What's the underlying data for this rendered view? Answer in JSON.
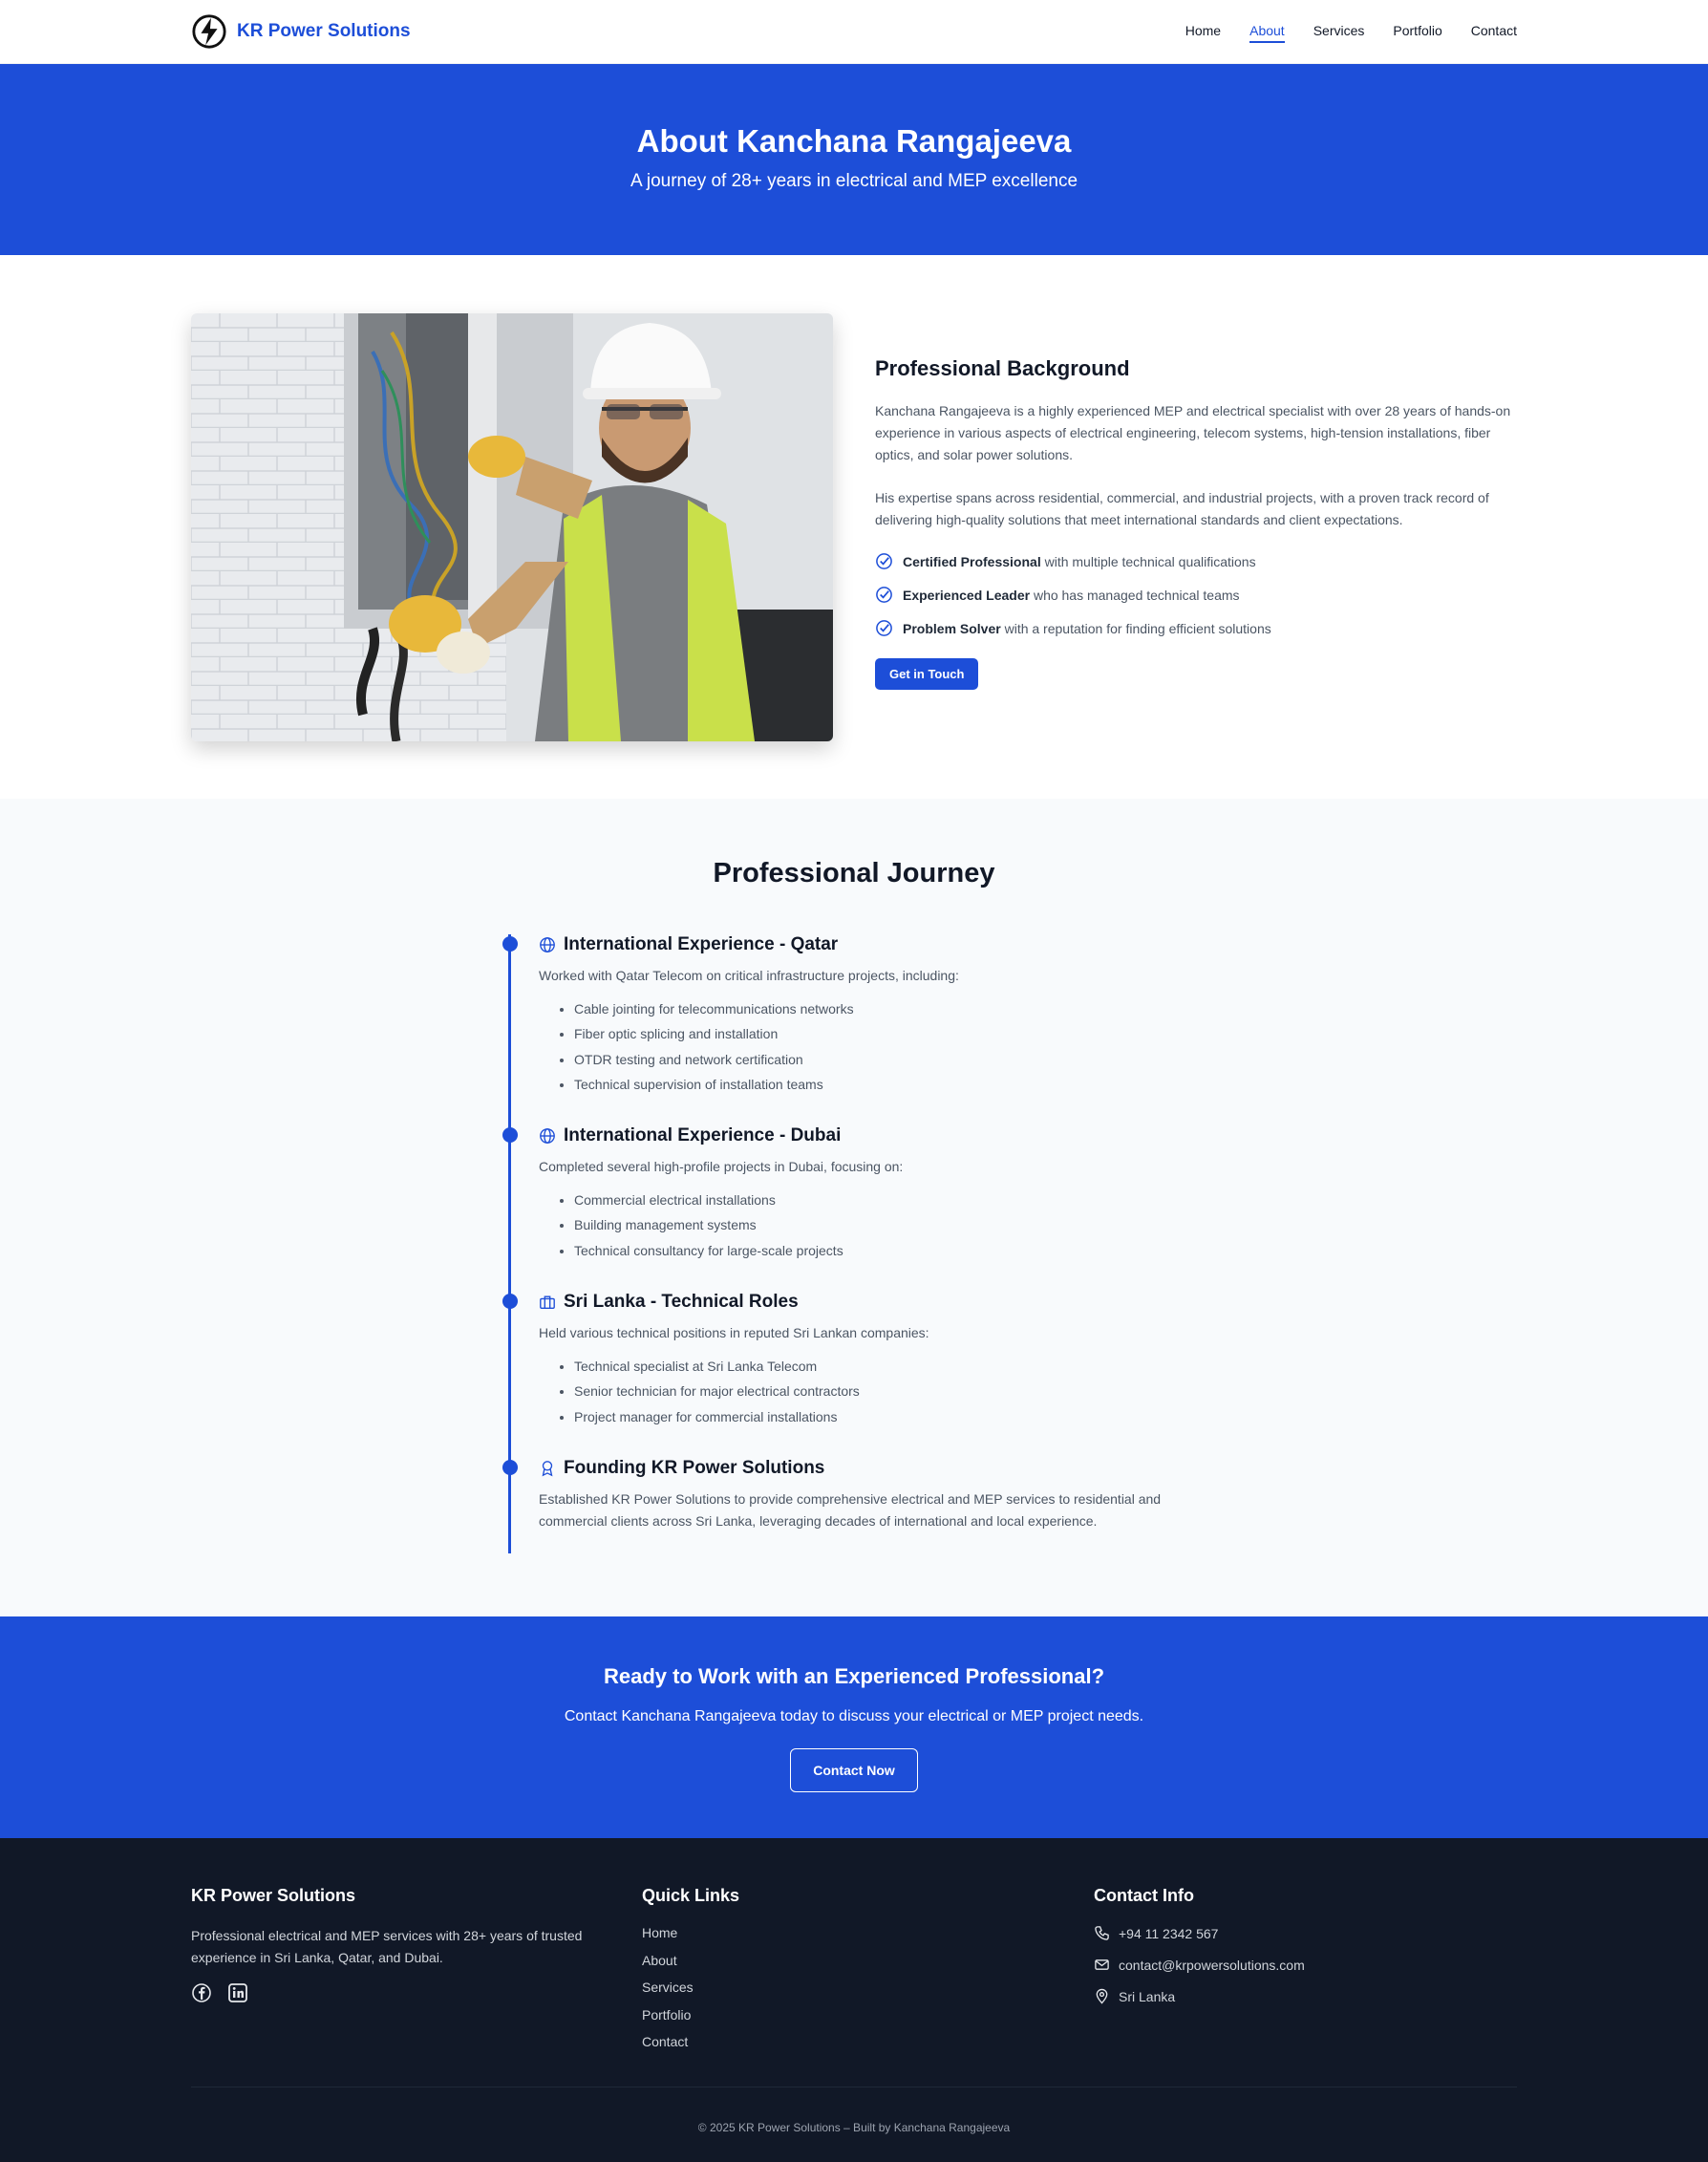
{
  "nav": {
    "brand": "KR Power Solutions",
    "links": [
      "Home",
      "About",
      "Services",
      "Portfolio",
      "Contact"
    ],
    "active": "About"
  },
  "hero": {
    "title": "About Kanchana Rangajeeva",
    "subtitle": "A journey of 28+ years in electrical and MEP excellence"
  },
  "background": {
    "heading": "Professional Background",
    "para1": "Kanchana Rangajeeva is a highly experienced MEP and electrical specialist with over 28 years of hands-on experience in various aspects of electrical engineering, telecom systems, high-tension installations, fiber optics, and solar power solutions.",
    "para2": "His expertise spans across residential, commercial, and industrial projects, with a proven track record of delivering high-quality solutions that meet international standards and client expectations.",
    "highlights": [
      {
        "bold": "Certified Professional",
        "text": " with multiple technical qualifications"
      },
      {
        "bold": "Experienced Leader",
        "text": " who has managed technical teams"
      },
      {
        "bold": "Problem Solver",
        "text": " with a reputation for finding efficient solutions"
      }
    ],
    "button": "Get in Touch"
  },
  "journey": {
    "heading": "Professional Journey",
    "items": [
      {
        "icon": "globe-icon",
        "title": "International Experience - Qatar",
        "desc": "Worked with Qatar Telecom on critical infrastructure projects, including:",
        "bullets": [
          "Cable jointing for telecommunications networks",
          "Fiber optic splicing and installation",
          "OTDR testing and network certification",
          "Technical supervision of installation teams"
        ]
      },
      {
        "icon": "globe-icon",
        "title": "International Experience - Dubai",
        "desc": "Completed several high-profile projects in Dubai, focusing on:",
        "bullets": [
          "Commercial electrical installations",
          "Building management systems",
          "Technical consultancy for large-scale projects"
        ]
      },
      {
        "icon": "briefcase-icon",
        "title": "Sri Lanka - Technical Roles",
        "desc": "Held various technical positions in reputed Sri Lankan companies:",
        "bullets": [
          "Technical specialist at Sri Lanka Telecom",
          "Senior technician for major electrical contractors",
          "Project manager for commercial installations"
        ]
      },
      {
        "icon": "award-icon",
        "title": "Founding KR Power Solutions",
        "desc": "Established KR Power Solutions to provide comprehensive electrical and MEP services to residential and commercial clients across Sri Lanka, leveraging decades of international and local experience.",
        "bullets": []
      }
    ]
  },
  "cta": {
    "title": "Ready to Work with an Experienced Professional?",
    "text": "Contact Kanchana Rangajeeva today to discuss your electrical or MEP project needs.",
    "button": "Contact Now"
  },
  "footer": {
    "about_title": "KR Power Solutions",
    "about_text": "Professional electrical and MEP services with 28+ years of trusted experience in Sri Lanka, Qatar, and Dubai.",
    "links_title": "Quick Links",
    "links": [
      "Home",
      "About",
      "Services",
      "Portfolio",
      "Contact"
    ],
    "contact_title": "Contact Info",
    "phone": "+94 11 2342 567",
    "email": "contact@krpowersolutions.com",
    "location": "Sri Lanka",
    "copyright": "© 2025 KR Power Solutions – Built by Kanchana Rangajeeva"
  },
  "colors": {
    "accent": "#1d4ed8",
    "footer_bg": "#111827",
    "section_alt": "#f8fafc"
  }
}
